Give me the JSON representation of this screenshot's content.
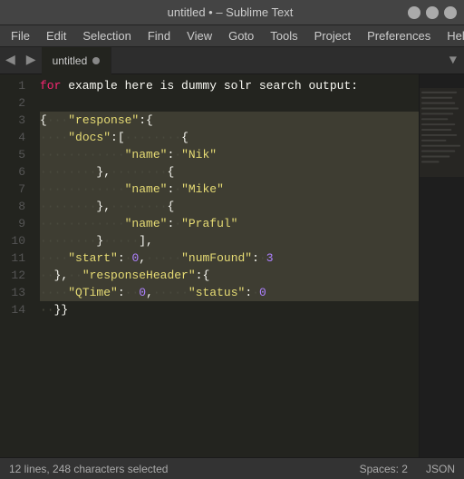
{
  "titleBar": {
    "title": "untitled • – Sublime Text",
    "minimizeLabel": "–",
    "maximizeLabel": "□",
    "closeLabel": "×"
  },
  "menuBar": {
    "items": [
      "File",
      "Edit",
      "Selection",
      "Find",
      "View",
      "Goto",
      "Tools",
      "Project",
      "Preferences",
      "Help"
    ]
  },
  "tabBar": {
    "navLeft": "◀",
    "navRight": "▶",
    "tabs": [
      {
        "label": "untitled",
        "active": true
      }
    ],
    "dropdownIcon": "▼"
  },
  "editor": {
    "lines": [
      {
        "num": 1,
        "content": "for example here is dummy solr search output:",
        "selected": false
      },
      {
        "num": 2,
        "content": "",
        "selected": false
      },
      {
        "num": 3,
        "content": "{···\"response\":{",
        "selected": true
      },
      {
        "num": 4,
        "content": "····\"docs\":[········{",
        "selected": true
      },
      {
        "num": 5,
        "content": "············\"name\":·\"Nik\"",
        "selected": true
      },
      {
        "num": 6,
        "content": "········},········{",
        "selected": true
      },
      {
        "num": 7,
        "content": "············\"name\":·\"Mike\"",
        "selected": true
      },
      {
        "num": 8,
        "content": "········},········{",
        "selected": true
      },
      {
        "num": 9,
        "content": "············\"name\":·\"Praful\"",
        "selected": true
      },
      {
        "num": 10,
        "content": "········}·····],",
        "selected": true
      },
      {
        "num": 11,
        "content": "····\"start\":·0,·····\"numFound\":·3",
        "selected": true
      },
      {
        "num": 12,
        "content": "··},··\"responseHeader\":{",
        "selected": true
      },
      {
        "num": 13,
        "content": "····\"QTime\":··0,·····\"status\":·0",
        "selected": true
      },
      {
        "num": 14,
        "content": "··}}",
        "selected": false
      }
    ]
  },
  "statusBar": {
    "left": "12 lines, 248 characters selected",
    "spaces": "Spaces: 2",
    "syntax": "JSON"
  }
}
